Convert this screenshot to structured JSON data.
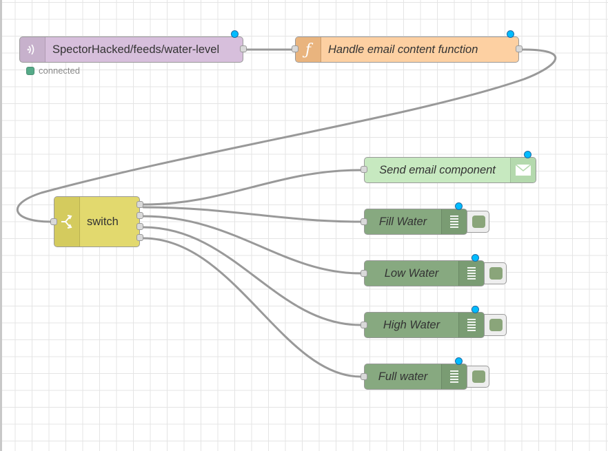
{
  "flow": {
    "mqtt_node": {
      "label": "SpectorHacked/feeds/water-level",
      "status": "connected",
      "icon": "bridge-icon",
      "color": "#d7bfdc"
    },
    "function_node": {
      "label": "Handle email content function",
      "icon": "function-icon",
      "color": "#fdd0a2"
    },
    "email_node": {
      "label": "Send email component",
      "icon": "envelope-icon",
      "color": "#c7e9c0"
    },
    "switch_node": {
      "label": "switch",
      "icon": "switch-icon",
      "color": "#e2d96e"
    },
    "debug_nodes": [
      {
        "label": "Fill Water",
        "icon": "debug-list-icon"
      },
      {
        "label": "Low Water",
        "icon": "debug-list-icon"
      },
      {
        "label": "High Water",
        "icon": "debug-list-icon"
      },
      {
        "label": "Full water",
        "icon": "debug-list-icon"
      }
    ],
    "colors": {
      "debug": "#87a980",
      "wire": "#999999",
      "changed_marker": "#00bcff",
      "status_connected": "#55aa88"
    }
  }
}
